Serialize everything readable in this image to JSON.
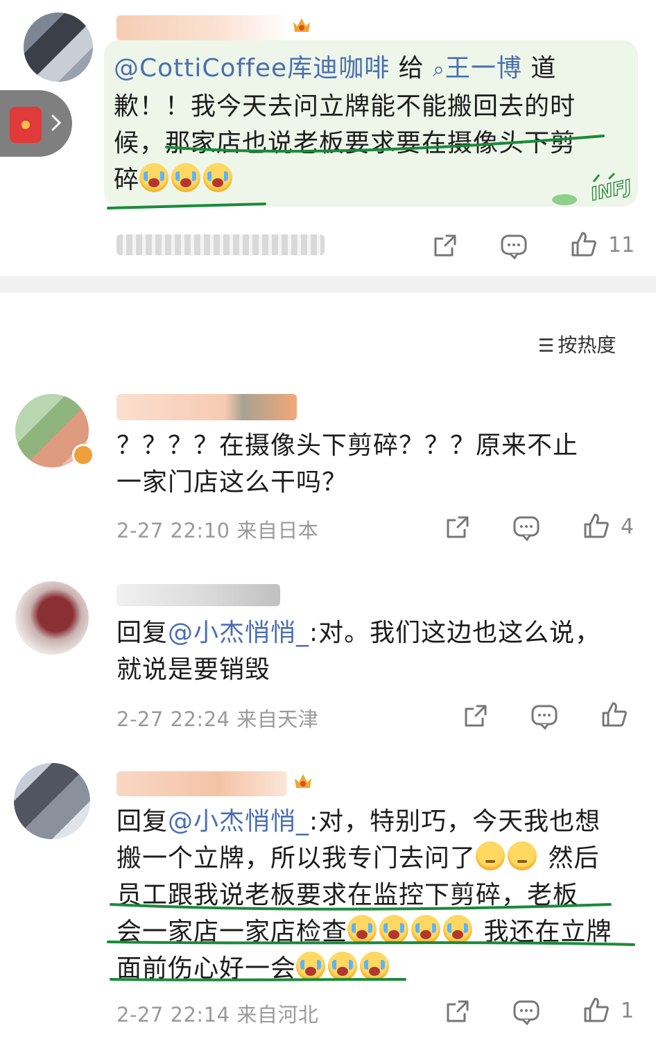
{
  "post": {
    "content_parts": [
      "@CottiCoffee库迪咖啡",
      " 给 ",
      "王一博",
      " 道歉！！我今天去问立牌能不能搬回去的时候，那家店也说老板要求要在摄像头下剪碎"
    ],
    "line1_a": "@CottiCoffee库迪咖啡",
    "line1_b": " 给 ",
    "line1_c": "王一博",
    "line1_d": " 道",
    "line2": "歉！！我今天去问立牌能不能搬回去的时",
    "line3": "候，那家店也说老板要求要在摄像头下剪",
    "line4": "碎",
    "sticker_text": "INFJ",
    "like_count": "11"
  },
  "sort": {
    "label": "按热度",
    "icon": "sort-icon"
  },
  "comments": [
    {
      "line1": "？？？？在摄像头下剪碎？？？原来不止",
      "line2": "一家门店这么干吗？",
      "time": "2-27 22:10",
      "location": "来自日本",
      "like_count": "4"
    },
    {
      "reply_prefix": "回复",
      "mention": "@小杰悄悄_",
      "line1_rest": ":对。我们这边也这么说，",
      "line2": "就说是要销毁",
      "time": "2-27 22:24",
      "location": "来自天津",
      "like_count": ""
    },
    {
      "reply_prefix": "回复",
      "mention": "@小杰悄悄_",
      "line1_rest": ":对，特别巧，今天我也想",
      "line2": "搬一个立牌，所以我专门去问了",
      "line2_tail": " 然后",
      "line3": "员工跟我说老板要求在监控下剪碎，老板",
      "line4": "会一家店一家店检查",
      "line4_tail": " 我还在立牌",
      "line5": "面前伤心好一会",
      "time": "2-27 22:14",
      "location": "来自河北",
      "like_count": "1"
    }
  ],
  "colors": {
    "underline": "#1a8a3a",
    "link": "#4a6fb0",
    "post_bg": "#eef6ea",
    "meta": "#9a9a9a"
  }
}
